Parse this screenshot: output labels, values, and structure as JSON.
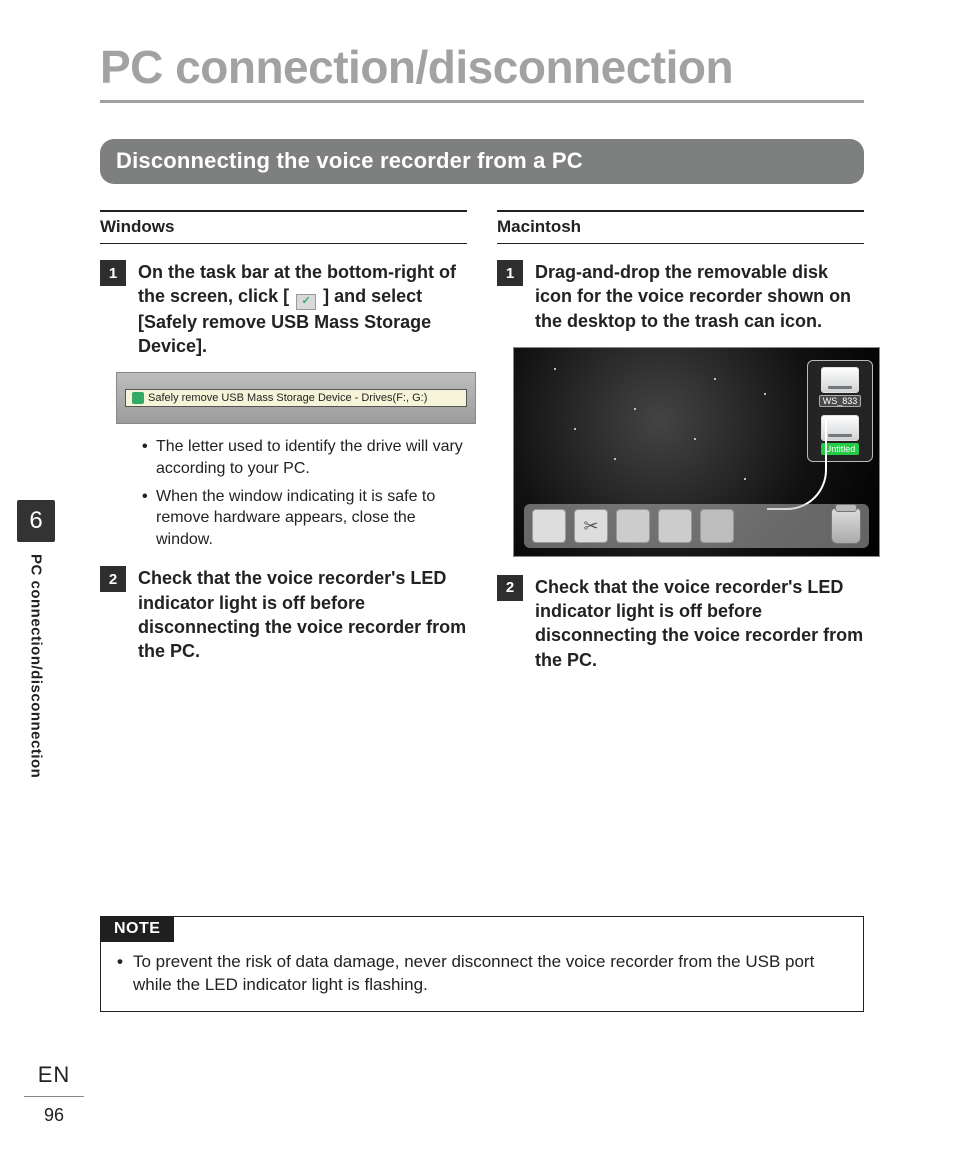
{
  "page": {
    "title": "PC connection/disconnection",
    "section_title": "Disconnecting the voice recorder from a PC",
    "chapter_number": "6",
    "side_label": "PC connection/disconnection",
    "language": "EN",
    "page_number": "96"
  },
  "windows": {
    "heading": "Windows",
    "step1": {
      "num": "1",
      "text_pre": "On the task bar at the bottom-right of the screen, click [",
      "text_post": "] and select [",
      "bold_option": "Safely remove USB Mass Storage Device",
      "text_close": "]."
    },
    "screenshot_tooltip": "Safely remove USB Mass Storage Device - Drives(F:, G:)",
    "bullets": [
      "The letter used to identify the drive will vary according to your PC.",
      "When the window indicating it is safe to remove hardware appears, close the window."
    ],
    "step2": {
      "num": "2",
      "text": "Check that the voice recorder's LED indicator light is off before disconnecting the voice recorder from the PC."
    }
  },
  "mac": {
    "heading": "Macintosh",
    "step1": {
      "num": "1",
      "text": "Drag-and-drop the removable disk icon for the voice recorder shown on the desktop to the trash can icon."
    },
    "drives": [
      {
        "label": "WS_833"
      },
      {
        "label": "Untitled"
      }
    ],
    "step2": {
      "num": "2",
      "text": "Check that the voice recorder's LED indicator light is off before disconnecting the voice recorder from the PC."
    }
  },
  "note": {
    "label": "NOTE",
    "items": [
      "To prevent the risk of data damage, never disconnect the voice recorder from the USB port while the LED indicator light is flashing."
    ]
  }
}
